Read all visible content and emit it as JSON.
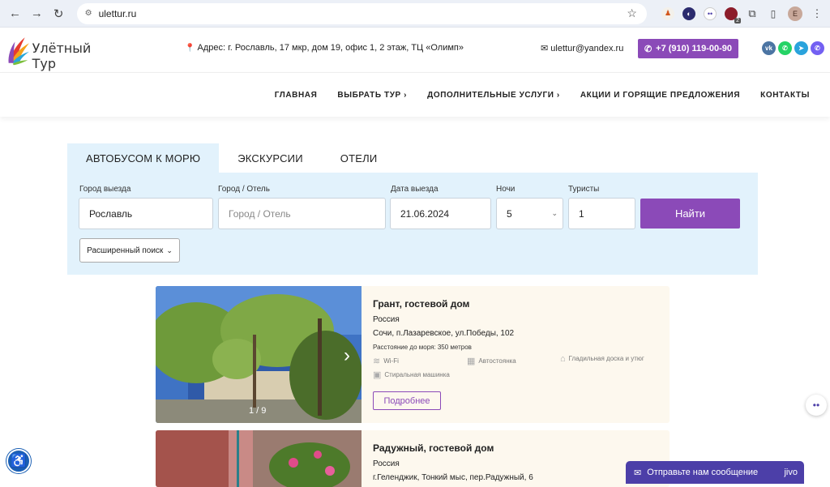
{
  "browser": {
    "url": "ulettur.ru",
    "profile_initial": "E",
    "ext_badge": "2"
  },
  "header": {
    "logo_text": "Улётный Тур",
    "address": "Адрес: г. Рославль, 17 мкр, дом 19, офис 1, 2 этаж, ТЦ «Олимп»",
    "email": "ulettur@yandex.ru",
    "phone": "+7 (910) 119-00-90",
    "accent": "#8b4ab8"
  },
  "menu": [
    {
      "label": "ГЛАВНАЯ"
    },
    {
      "label": "ВЫБРАТЬ ТУР ›"
    },
    {
      "label": "ДОПОЛНИТЕЛЬНЫЕ УСЛУГИ ›"
    },
    {
      "label": "АКЦИИ И ГОРЯЩИЕ ПРЕДЛОЖЕНИЯ"
    },
    {
      "label": "КОНТАКТЫ"
    }
  ],
  "search": {
    "tabs": [
      "АВТОБУСОМ К МОРЮ",
      "ЭКСКУРСИИ",
      "ОТЕЛИ"
    ],
    "labels": {
      "departure_city": "Город выезда",
      "city_hotel": "Город / Отель",
      "departure_date": "Дата выезда",
      "nights": "Ночи",
      "tourists": "Туристы"
    },
    "values": {
      "departure_city": "Рославль",
      "city_hotel_placeholder": "Город / Отель",
      "departure_date": "21.06.2024",
      "nights": "5",
      "tourists": "1"
    },
    "find_label": "Найти",
    "advanced_label": "Расширенный поиск"
  },
  "hotels": [
    {
      "title": "Грант, гостевой дом",
      "country": "Россия",
      "address": "Сочи, п.Лазаревское, ул.Победы, 102",
      "distance": "Расстояние до моря: 350 метров",
      "amenities": [
        "Wi-Fi",
        "Автостоянка",
        "Гладильная доска и утюг",
        "Стиральная машинка"
      ],
      "more_label": "Подробнее",
      "photo_counter": "1 / 9"
    },
    {
      "title": "Радужный, гостевой дом",
      "country": "Россия",
      "address": "г.Геленджик, Тонкий мыс, пер.Радужный, 6"
    }
  ],
  "widgets": {
    "chat_label": "Отправьте нам сообщение",
    "chat_brand": "jivo"
  }
}
